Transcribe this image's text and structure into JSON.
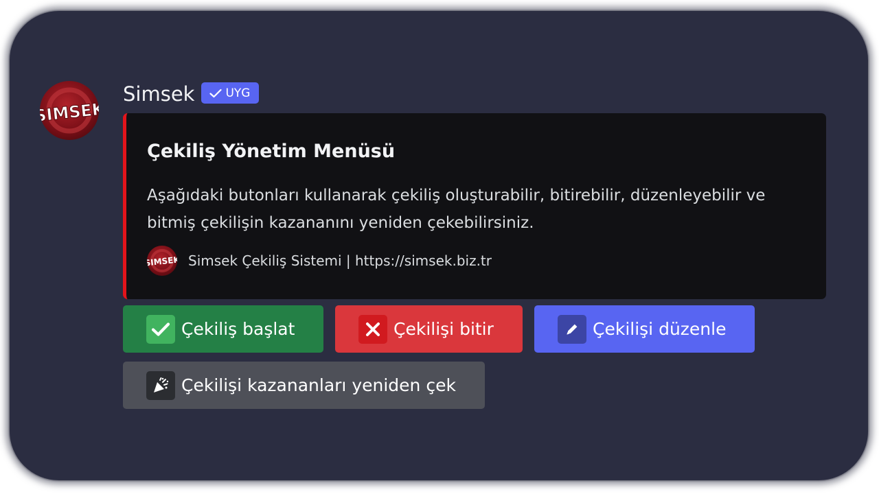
{
  "message": {
    "author": "Simsek",
    "badge": "UYG",
    "avatar_text": "SIMSEK"
  },
  "embed": {
    "title": "Çekiliş Yönetim Menüsü",
    "description": "Aşağıdaki butonları kullanarak çekiliş oluşturabilir, bitirebilir, düzenleyebilir ve bitmiş çekilişin kazananını yeniden çekebilirsiniz.",
    "footer": "Simsek Çekiliş Sistemi | https://simsek.biz.tr",
    "accent_color": "#e3141b"
  },
  "buttons": [
    {
      "label": "Çekiliş başlat",
      "icon": "check-icon",
      "color": "#248046"
    },
    {
      "label": "Çekilişi bitir",
      "icon": "cross-icon",
      "color": "#da373c"
    },
    {
      "label": "Çekilişi düzenle",
      "icon": "pencil-icon",
      "color": "#5865f2"
    },
    {
      "label": "Çekilişi kazananları yeniden çek",
      "icon": "party-popper-icon",
      "color": "#4e5058"
    }
  ],
  "colors": {
    "background": "#2b2d41",
    "embed_background": "#111114",
    "app_badge": "#5865f2"
  }
}
